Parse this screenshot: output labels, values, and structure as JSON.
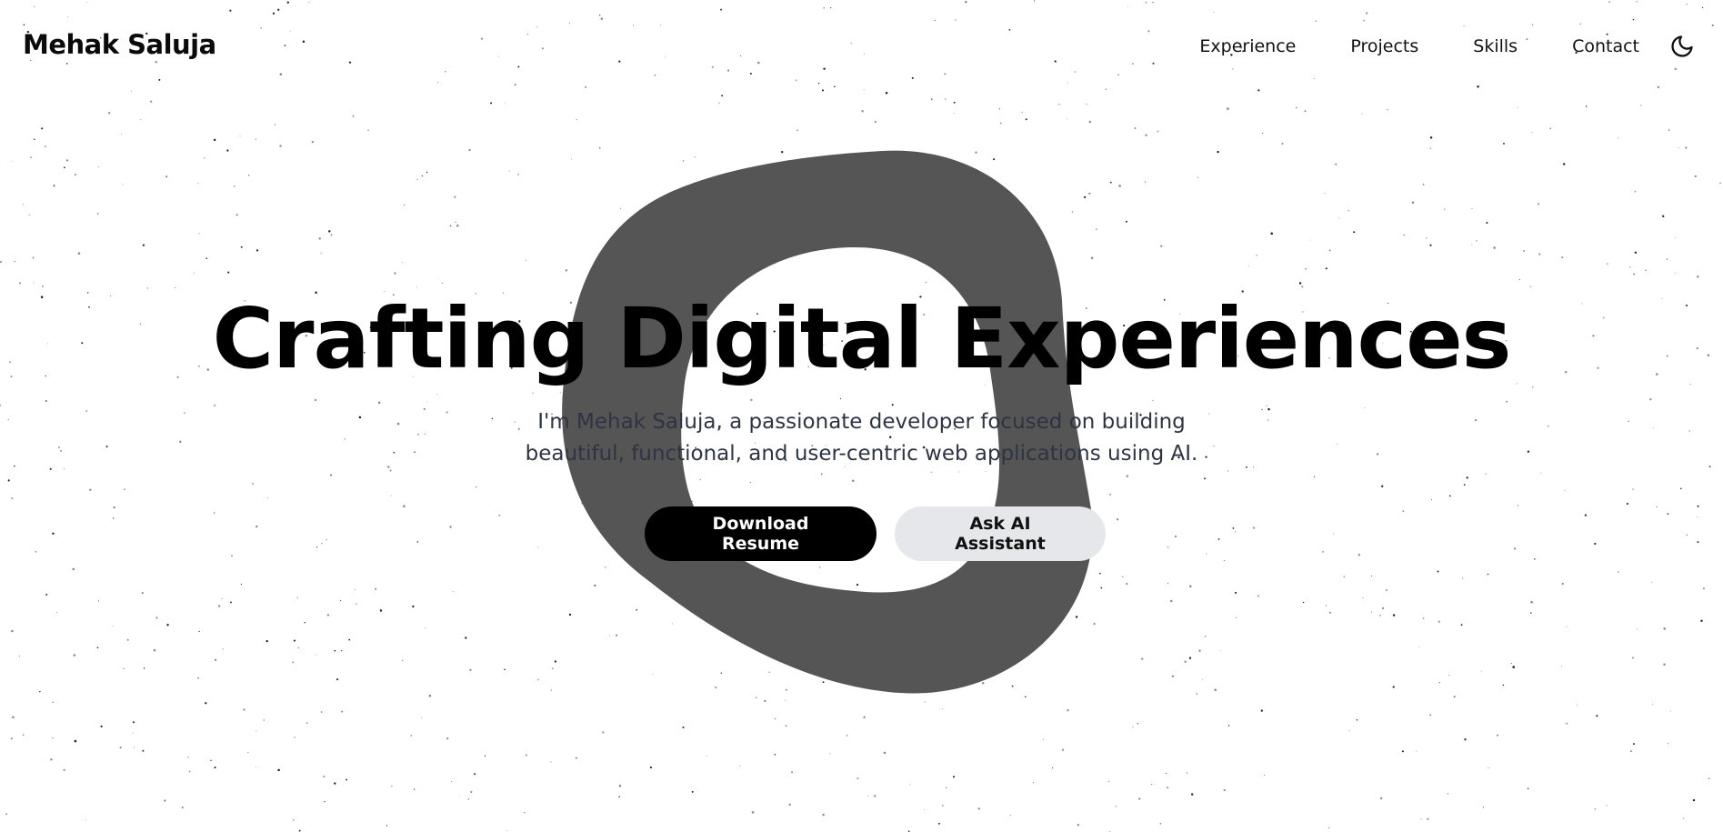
{
  "header": {
    "brand": "Mehak Saluja",
    "nav": [
      {
        "label": "Experience"
      },
      {
        "label": "Projects"
      },
      {
        "label": "Skills"
      },
      {
        "label": "Contact"
      }
    ],
    "theme_toggle_icon": "moon-icon"
  },
  "hero": {
    "headline": "Crafting Digital Experiences",
    "subtitle": "I'm Mehak Saluja, a passionate developer focused on building beautiful, functional, and user-centric web applications using AI.",
    "primary_button": "Download Resume",
    "secondary_button": "Ask AI Assistant"
  },
  "colors": {
    "background": "#ffffff",
    "blob": "#555555",
    "text": "#000000",
    "subtitle": "#2e3442",
    "primary_button_bg": "#000000",
    "secondary_button_bg": "#e6e7eb"
  }
}
